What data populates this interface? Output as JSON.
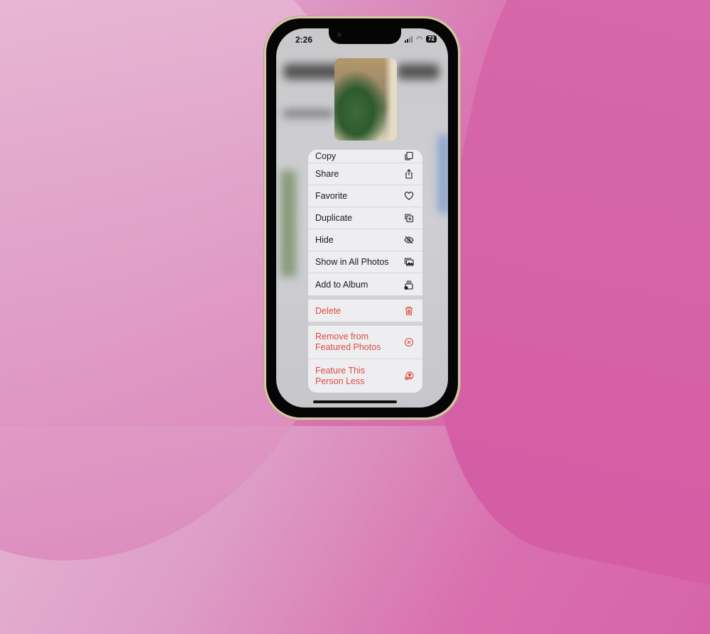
{
  "status_bar": {
    "time": "2:26",
    "battery": "72"
  },
  "menu": {
    "items": [
      {
        "label": "Copy",
        "icon": "copy-icon"
      },
      {
        "label": "Share",
        "icon": "share-icon"
      },
      {
        "label": "Favorite",
        "icon": "heart-icon"
      },
      {
        "label": "Duplicate",
        "icon": "duplicate-icon"
      },
      {
        "label": "Hide",
        "icon": "eye-slash-icon"
      },
      {
        "label": "Show in All Photos",
        "icon": "photos-icon"
      },
      {
        "label": "Add to Album",
        "icon": "add-album-icon"
      }
    ],
    "delete": {
      "label": "Delete",
      "icon": "trash-icon"
    },
    "remove_featured": {
      "label_1": "Remove from",
      "label_2": "Featured Photos",
      "icon": "x-circle-icon"
    },
    "feature_less": {
      "label_1": "Feature This",
      "label_2": "Person Less",
      "icon": "person-minus-icon"
    }
  },
  "colors": {
    "destructive": "#dd4b45",
    "menu_bg": "#eeeef0",
    "background": "#d96fae"
  }
}
